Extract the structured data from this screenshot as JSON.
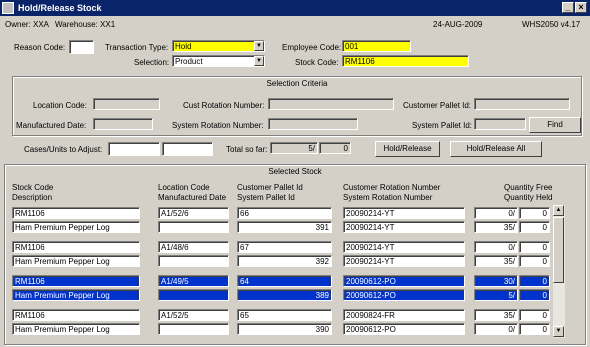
{
  "window": {
    "title": "Hold/Release Stock"
  },
  "info": {
    "owner": "Owner: XXA",
    "warehouse": "Warehouse: XX1",
    "date": "24-AUG-2009",
    "version": "WHS2050  v4.17"
  },
  "form": {
    "reason_code_label": "Reason Code:",
    "reason_code_value": "",
    "transaction_type_label": "Transaction Type:",
    "transaction_type_value": "Hold",
    "employee_code_label": "Employee Code:",
    "employee_code_value": "001",
    "selection_label": "Selection:",
    "selection_value": "Product",
    "stock_code_label": "Stock Code:",
    "stock_code_value": "RM1106"
  },
  "criteria": {
    "title": "Selection Criteria",
    "location_code_label": "Location Code:",
    "cust_rotation_label": "Cust Rotation Number:",
    "customer_pallet_label": "Customer Pallet Id:",
    "manufactured_date_label": "Manufactured Date:",
    "system_rotation_label": "System Rotation Number:",
    "system_pallet_label": "System Pallet Id:",
    "find_button": "Find"
  },
  "adjust": {
    "cases_label": "Cases/Units to Adjust:",
    "total_label": "Total so far:",
    "total_value": "5/",
    "total_value2": "0",
    "hold_release_button": "Hold/Release",
    "hold_release_all_button": "Hold/Release All"
  },
  "selected": {
    "title": "Selected Stock",
    "headers": {
      "c1a": "Stock Code",
      "c1b": "Description",
      "c2a": "Location Code",
      "c2b": "Manufactured Date",
      "c3a": "Customer Pallet Id",
      "c3b": "System Pallet Id",
      "c4a": "Customer Rotation Number",
      "c4b": "System Rotation Number",
      "c5a": "Quantity Free",
      "c5b": "Quantity Held"
    },
    "records": [
      {
        "stock": "RM1106",
        "desc": "Ham Premium Pepper Log",
        "loc": "A1/52/6",
        "mfg": "",
        "cpallet": "66",
        "spallet": "391",
        "crot": "20090214-YT",
        "srot": "20090214-YT",
        "qfree": "0/",
        "qfree2": "0",
        "qheld": "35/",
        "qheld2": "0",
        "selected": false
      },
      {
        "stock": "RM1106",
        "desc": "Ham Premium Pepper Log",
        "loc": "A1/48/6",
        "mfg": "",
        "cpallet": "67",
        "spallet": "392",
        "crot": "20090214-YT",
        "srot": "20090214-YT",
        "qfree": "0/",
        "qfree2": "0",
        "qheld": "35/",
        "qheld2": "0",
        "selected": false
      },
      {
        "stock": "RM1106",
        "desc": "Ham Premium Pepper Log",
        "loc": "A1/49/5",
        "mfg": "",
        "cpallet": "64",
        "spallet": "389",
        "crot": "20090612-PO",
        "srot": "20090612-PO",
        "qfree": "30/",
        "qfree2": "0",
        "qheld": "5/",
        "qheld2": "0",
        "selected": true
      },
      {
        "stock": "RM1106",
        "desc": "Ham Premium Pepper Log",
        "loc": "A1/52/5",
        "mfg": "",
        "cpallet": "65",
        "spallet": "390",
        "crot": "20090824-FR",
        "srot": "20090612-PO",
        "qfree": "35/",
        "qfree2": "0",
        "qheld": "0/",
        "qheld2": "0",
        "selected": false
      }
    ]
  }
}
